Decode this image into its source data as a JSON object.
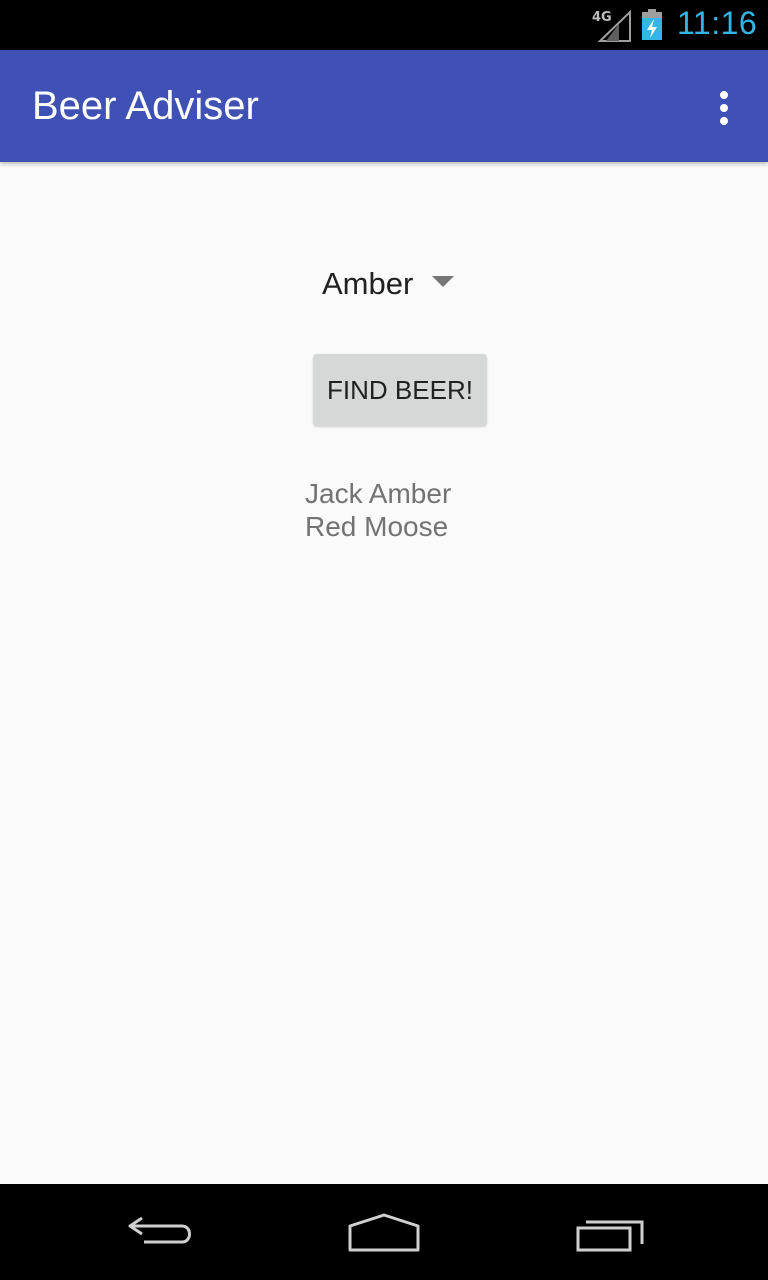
{
  "status_bar": {
    "network": "4G",
    "time": "11:16",
    "icons": [
      "signal-icon",
      "battery-charging-icon"
    ]
  },
  "app_bar": {
    "title": "Beer Adviser",
    "overflow_icon": "more-vert-icon",
    "color": "#3f51b5"
  },
  "content": {
    "spinner": {
      "selected": "Amber",
      "icon": "dropdown-arrow-icon"
    },
    "find_button": {
      "label": "FIND BEER!"
    },
    "results": [
      "Jack Amber",
      "Red Moose"
    ]
  },
  "nav_bar": {
    "icons": [
      "back-icon",
      "home-icon",
      "recents-icon"
    ]
  }
}
